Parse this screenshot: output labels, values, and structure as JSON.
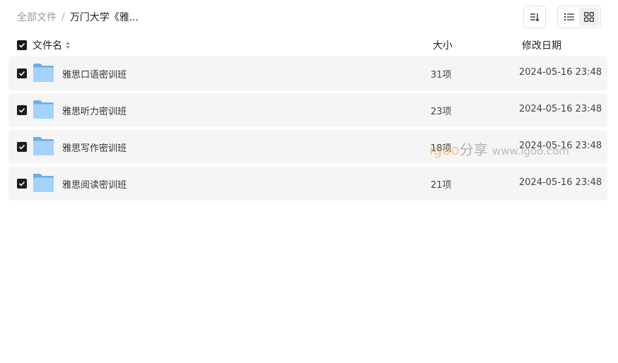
{
  "breadcrumb": {
    "root": "全部文件",
    "separator": "/",
    "current": "万门大学《雅..."
  },
  "toolbar": {
    "sort_icon": "sort-icon",
    "list_view_icon": "list-view-icon",
    "grid_view_icon": "grid-view-icon"
  },
  "table": {
    "header": {
      "name": "文件名",
      "size": "大小",
      "date": "修改日期"
    },
    "rows": [
      {
        "name": "雅思口语密训班",
        "size": "31项",
        "date": "2024-05-16 23:48"
      },
      {
        "name": "雅思听力密训班",
        "size": "23项",
        "date": "2024-05-16 23:48"
      },
      {
        "name": "雅思写作密训班",
        "size": "18项",
        "date": "2024-05-16 23:48"
      },
      {
        "name": "雅思阅读密训班",
        "size": "21项",
        "date": "2024-05-16 23:48"
      }
    ]
  },
  "watermark": {
    "brand": "igoo",
    "cn": "分享",
    "url": "www.igoo.com"
  },
  "colors": {
    "row_bg": "#f5f5f5",
    "checkbox": "#1b1b1b",
    "folder": "#8cc4f4"
  }
}
